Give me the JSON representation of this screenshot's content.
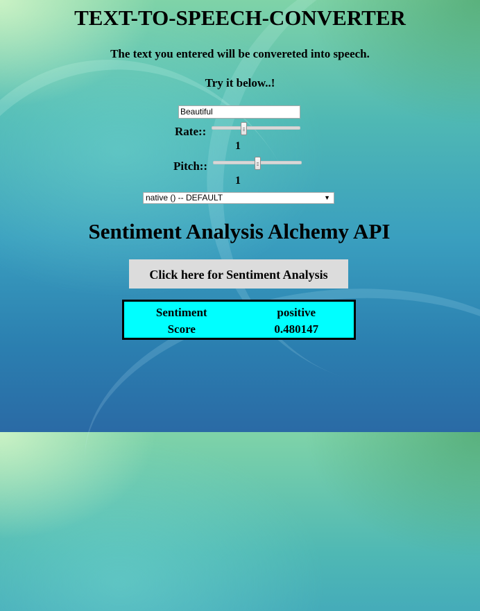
{
  "header": {
    "title": "TEXT-TO-SPEECH-CONVERTER",
    "subtitle": "The text you entered will be convereted into speech.",
    "instruction": "Try it below..!"
  },
  "speech": {
    "text_value": "Beautiful",
    "rate": {
      "label": "Rate::",
      "value": "1",
      "fraction": 0.35
    },
    "pitch": {
      "label": "Pitch::",
      "value": "1",
      "fraction": 0.5
    },
    "voice": {
      "selected": "native () -- DEFAULT"
    }
  },
  "sentiment": {
    "section_title": "Sentiment Analysis Alchemy API",
    "button_label": "Click here for Sentiment Analysis",
    "rows": [
      {
        "key": "Sentiment",
        "value": "positive"
      },
      {
        "key": "Score",
        "value": "0.480147"
      }
    ],
    "box_color": "#00ffff"
  }
}
